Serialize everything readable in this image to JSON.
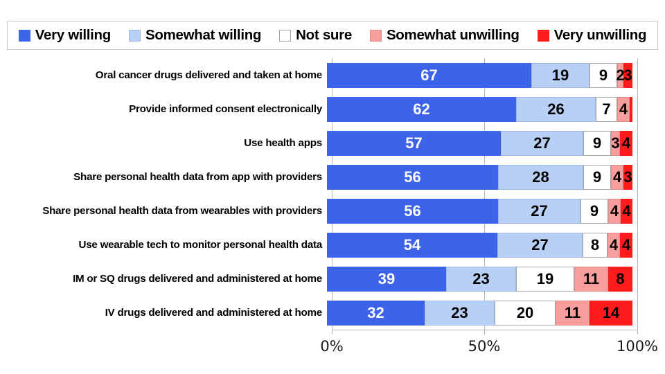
{
  "legend": {
    "items": [
      {
        "label": "Very willing",
        "color": "#3D63E8",
        "key": "very_willing"
      },
      {
        "label": "Somewhat willing",
        "color": "#B8D0F5",
        "key": "somewhat_willing"
      },
      {
        "label": "Not sure",
        "color": "#FFFFFF",
        "key": "not_sure"
      },
      {
        "label": "Somewhat unwilling",
        "color": "#FA9D9D",
        "key": "somewhat_unwilling"
      },
      {
        "label": "Very unwilling",
        "color": "#FC1C1C",
        "key": "very_unwilling"
      }
    ]
  },
  "axis": {
    "ticks": [
      {
        "label": "0%",
        "value": 0
      },
      {
        "label": "50%",
        "value": 50
      },
      {
        "label": "100%",
        "value": 100
      }
    ]
  },
  "chart_data": {
    "type": "bar",
    "subtype": "stacked-horizontal-100pct",
    "title": "",
    "xlabel": "",
    "ylabel": "",
    "xlim": [
      0,
      100
    ],
    "grid": true,
    "legend_position": "top",
    "categories": [
      "Oral cancer drugs delivered and taken at home",
      "Provide informed consent electronically",
      "Use health apps",
      "Share personal health data from app with providers",
      "Share personal health data from wearables with providers",
      "Use wearable tech to monitor personal health data",
      "IM or SQ drugs delivered and administered at home",
      "IV drugs delivered and administered at home"
    ],
    "series": [
      {
        "name": "Very willing",
        "values": [
          67,
          62,
          57,
          56,
          56,
          54,
          39,
          32
        ]
      },
      {
        "name": "Somewhat willing",
        "values": [
          19,
          26,
          27,
          28,
          27,
          27,
          23,
          23
        ]
      },
      {
        "name": "Not sure",
        "values": [
          9,
          7,
          9,
          9,
          9,
          8,
          19,
          20
        ]
      },
      {
        "name": "Somewhat unwilling",
        "values": [
          2,
          4,
          3,
          4,
          4,
          4,
          11,
          11
        ]
      },
      {
        "name": "Very unwilling",
        "values": [
          3,
          1,
          4,
          3,
          4,
          4,
          8,
          14
        ]
      }
    ],
    "value_labels": [
      [
        "67",
        "19",
        "9",
        "2",
        "3"
      ],
      [
        "62",
        "26",
        "7",
        "4",
        ""
      ],
      [
        "57",
        "27",
        "9",
        "3",
        "4"
      ],
      [
        "56",
        "28",
        "9",
        "4",
        "3"
      ],
      [
        "56",
        "27",
        "9",
        "4",
        "4"
      ],
      [
        "54",
        "27",
        "8",
        "4",
        "4"
      ],
      [
        "39",
        "23",
        "19",
        "11",
        "8"
      ],
      [
        "32",
        "23",
        "20",
        "11",
        "14"
      ]
    ]
  }
}
